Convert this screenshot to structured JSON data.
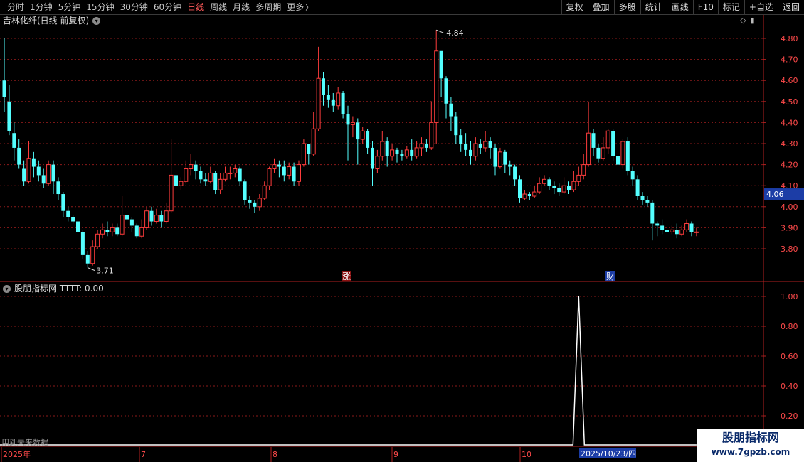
{
  "topbar": {
    "tabs": [
      "分时",
      "1分钟",
      "5分钟",
      "15分钟",
      "30分钟",
      "60分钟",
      "日线",
      "周线",
      "月线",
      "多周期",
      "更多"
    ],
    "active_tab": "日线",
    "tools": [
      "复权",
      "叠加",
      "多股",
      "统计",
      "画线",
      "F10",
      "标记",
      "+自选",
      "返回"
    ]
  },
  "chart_title": "吉林化纤(日线 前复权)",
  "indicator_title": "股朋指标网 TTTT: 0.00",
  "future_note": "用到未来数据",
  "watermark": {
    "line1": "股朋指标网",
    "line2": "www.7gpzb.com"
  },
  "colors": {
    "up": "#ff3c3c",
    "down": "#54ffff",
    "grid": "#8b1a1a",
    "axis_text": "#ff4a4a",
    "line": "#ffffff"
  },
  "chart_data": [
    {
      "type": "candlestick",
      "ylim": [
        3.7,
        4.9
      ],
      "yticks": [
        "4.80",
        "4.70",
        "4.60",
        "4.50",
        "4.40",
        "4.30",
        "4.20",
        "4.10",
        "4.00",
        "3.90",
        "3.80"
      ],
      "current_price": "4.06",
      "annotations": {
        "high": "4.84",
        "low": "3.71"
      },
      "event_marks": [
        "涨",
        "财"
      ],
      "candles": [
        [
          4.6,
          4.52,
          4.8,
          4.45
        ],
        [
          4.5,
          4.36,
          4.58,
          4.34
        ],
        [
          4.35,
          4.28,
          4.4,
          4.22
        ],
        [
          4.28,
          4.2,
          4.32,
          4.18
        ],
        [
          4.18,
          4.12,
          4.22,
          4.1
        ],
        [
          4.12,
          4.23,
          4.31,
          4.11
        ],
        [
          4.23,
          4.19,
          4.26,
          4.14
        ],
        [
          4.19,
          4.15,
          4.22,
          4.12
        ],
        [
          4.15,
          4.11,
          4.18,
          4.09
        ],
        [
          4.11,
          4.2,
          4.22,
          4.1
        ],
        [
          4.2,
          4.12,
          4.22,
          4.06
        ],
        [
          4.12,
          4.06,
          4.14,
          4.03
        ],
        [
          4.06,
          3.98,
          4.07,
          3.95
        ],
        [
          3.98,
          3.95,
          4.0,
          3.93
        ],
        [
          3.95,
          3.93,
          3.96,
          3.92
        ],
        [
          3.93,
          3.88,
          3.95,
          3.86
        ],
        [
          3.88,
          3.77,
          3.89,
          3.75
        ],
        [
          3.77,
          3.73,
          3.79,
          3.71
        ],
        [
          3.73,
          3.81,
          3.84,
          3.72
        ],
        [
          3.81,
          3.87,
          3.89,
          3.8
        ],
        [
          3.87,
          3.89,
          3.92,
          3.85
        ],
        [
          3.89,
          3.88,
          3.93,
          3.86
        ],
        [
          3.88,
          3.9,
          3.92,
          3.86
        ],
        [
          3.9,
          3.87,
          3.92,
          3.86
        ],
        [
          3.87,
          3.96,
          4.05,
          3.86
        ],
        [
          3.96,
          3.94,
          4.0,
          3.92
        ],
        [
          3.94,
          3.91,
          3.95,
          3.88
        ],
        [
          3.91,
          3.86,
          3.92,
          3.85
        ],
        [
          3.86,
          3.9,
          3.94,
          3.85
        ],
        [
          3.9,
          3.98,
          4.0,
          3.89
        ],
        [
          3.98,
          3.93,
          4.0,
          3.91
        ],
        [
          3.93,
          3.96,
          3.99,
          3.92
        ],
        [
          3.96,
          3.93,
          3.98,
          3.9
        ],
        [
          3.93,
          3.98,
          4.02,
          3.92
        ],
        [
          3.98,
          4.15,
          4.32,
          3.97
        ],
        [
          4.15,
          4.1,
          4.17,
          4.02
        ],
        [
          4.1,
          4.12,
          4.14,
          4.08
        ],
        [
          4.12,
          4.18,
          4.22,
          4.11
        ],
        [
          4.18,
          4.2,
          4.25,
          4.15
        ],
        [
          4.2,
          4.17,
          4.22,
          4.13
        ],
        [
          4.17,
          4.13,
          4.19,
          4.11
        ],
        [
          4.13,
          4.12,
          4.16,
          4.1
        ],
        [
          4.12,
          4.16,
          4.19,
          4.11
        ],
        [
          4.16,
          4.08,
          4.17,
          4.06
        ],
        [
          4.08,
          4.13,
          4.16,
          4.06
        ],
        [
          4.13,
          4.16,
          4.19,
          4.12
        ],
        [
          4.16,
          4.16,
          4.19,
          4.13
        ],
        [
          4.16,
          4.18,
          4.2,
          4.14
        ],
        [
          4.18,
          4.12,
          4.19,
          4.1
        ],
        [
          4.12,
          4.03,
          4.13,
          4.01
        ],
        [
          4.03,
          4.02,
          4.05,
          3.99
        ],
        [
          4.02,
          4.0,
          4.03,
          3.97
        ],
        [
          4.0,
          4.04,
          4.06,
          3.98
        ],
        [
          4.04,
          4.1,
          4.12,
          4.03
        ],
        [
          4.1,
          4.18,
          4.19,
          4.08
        ],
        [
          4.18,
          4.2,
          4.23,
          4.16
        ],
        [
          4.2,
          4.19,
          4.22,
          4.14
        ],
        [
          4.19,
          4.15,
          4.22,
          4.12
        ],
        [
          4.15,
          4.19,
          4.21,
          4.13
        ],
        [
          4.19,
          4.12,
          4.21,
          4.1
        ],
        [
          4.12,
          4.2,
          4.22,
          4.1
        ],
        [
          4.2,
          4.3,
          4.32,
          4.19
        ],
        [
          4.3,
          4.25,
          4.3,
          4.2
        ],
        [
          4.25,
          4.37,
          4.45,
          4.24
        ],
        [
          4.37,
          4.61,
          4.76,
          4.36
        ],
        [
          4.61,
          4.53,
          4.64,
          4.48
        ],
        [
          4.53,
          4.51,
          4.58,
          4.47
        ],
        [
          4.51,
          4.48,
          4.54,
          4.45
        ],
        [
          4.48,
          4.54,
          4.57,
          4.46
        ],
        [
          4.54,
          4.44,
          4.55,
          4.42
        ],
        [
          4.44,
          4.39,
          4.48,
          4.22
        ],
        [
          4.39,
          4.4,
          4.43,
          4.33
        ],
        [
          4.4,
          4.32,
          4.42,
          4.2
        ],
        [
          4.32,
          4.36,
          4.38,
          4.3
        ],
        [
          4.36,
          4.28,
          4.37,
          4.25
        ],
        [
          4.28,
          4.18,
          4.31,
          4.1
        ],
        [
          4.18,
          4.24,
          4.27,
          4.16
        ],
        [
          4.24,
          4.31,
          4.36,
          4.22
        ],
        [
          4.31,
          4.24,
          4.33,
          4.19
        ],
        [
          4.24,
          4.27,
          4.3,
          4.22
        ],
        [
          4.27,
          4.25,
          4.28,
          4.21
        ],
        [
          4.25,
          4.24,
          4.27,
          4.22
        ],
        [
          4.24,
          4.27,
          4.29,
          4.23
        ],
        [
          4.27,
          4.24,
          4.32,
          4.22
        ],
        [
          4.24,
          4.28,
          4.31,
          4.23
        ],
        [
          4.28,
          4.3,
          4.33,
          4.24
        ],
        [
          4.3,
          4.28,
          4.32,
          4.26
        ],
        [
          4.28,
          4.4,
          4.5,
          4.27
        ],
        [
          4.4,
          4.74,
          4.84,
          4.3
        ],
        [
          4.74,
          4.61,
          4.66,
          4.52
        ],
        [
          4.61,
          4.49,
          4.62,
          4.42
        ],
        [
          4.49,
          4.43,
          4.52,
          4.36
        ],
        [
          4.43,
          4.34,
          4.45,
          4.3
        ],
        [
          4.34,
          4.3,
          4.37,
          4.26
        ],
        [
          4.3,
          4.27,
          4.35,
          4.24
        ],
        [
          4.27,
          4.24,
          4.31,
          4.2
        ],
        [
          4.24,
          4.3,
          4.33,
          4.22
        ],
        [
          4.3,
          4.28,
          4.32,
          4.25
        ],
        [
          4.28,
          4.31,
          4.36,
          4.26
        ],
        [
          4.31,
          4.28,
          4.33,
          4.23
        ],
        [
          4.28,
          4.19,
          4.3,
          4.15
        ],
        [
          4.19,
          4.26,
          4.28,
          4.18
        ],
        [
          4.26,
          4.2,
          4.27,
          4.16
        ],
        [
          4.2,
          4.19,
          4.22,
          4.15
        ],
        [
          4.19,
          4.13,
          4.2,
          4.1
        ],
        [
          4.13,
          4.04,
          4.15,
          4.02
        ],
        [
          4.04,
          4.06,
          4.08,
          4.03
        ],
        [
          4.06,
          4.05,
          4.07,
          4.03
        ],
        [
          4.05,
          4.07,
          4.1,
          4.04
        ],
        [
          4.07,
          4.11,
          4.14,
          4.06
        ],
        [
          4.11,
          4.13,
          4.15,
          4.1
        ],
        [
          4.13,
          4.1,
          4.14,
          4.08
        ],
        [
          4.1,
          4.09,
          4.12,
          4.06
        ],
        [
          4.09,
          4.07,
          4.11,
          4.05
        ],
        [
          4.07,
          4.1,
          4.14,
          4.06
        ],
        [
          4.1,
          4.08,
          4.12,
          4.06
        ],
        [
          4.08,
          4.12,
          4.17,
          4.07
        ],
        [
          4.12,
          4.15,
          4.19,
          4.1
        ],
        [
          4.15,
          4.2,
          4.25,
          4.13
        ],
        [
          4.2,
          4.35,
          4.5,
          4.19
        ],
        [
          4.35,
          4.28,
          4.37,
          4.24
        ],
        [
          4.28,
          4.23,
          4.3,
          4.21
        ],
        [
          4.23,
          4.28,
          4.33,
          4.22
        ],
        [
          4.28,
          4.36,
          4.37,
          4.25
        ],
        [
          4.36,
          4.24,
          4.37,
          4.22
        ],
        [
          4.24,
          4.2,
          4.26,
          4.17
        ],
        [
          4.2,
          4.31,
          4.32,
          4.18
        ],
        [
          4.31,
          4.17,
          4.33,
          4.15
        ],
        [
          4.17,
          4.13,
          4.19,
          4.1
        ],
        [
          4.13,
          4.05,
          4.15,
          4.03
        ],
        [
          4.05,
          4.03,
          4.07,
          4.01
        ],
        [
          4.03,
          4.02,
          4.05,
          4.0
        ],
        [
          4.02,
          3.92,
          4.03,
          3.84
        ],
        [
          3.92,
          3.91,
          3.93,
          3.86
        ],
        [
          3.91,
          3.89,
          3.94,
          3.87
        ],
        [
          3.89,
          3.88,
          3.91,
          3.86
        ],
        [
          3.88,
          3.89,
          3.91,
          3.87
        ],
        [
          3.89,
          3.87,
          3.92,
          3.85
        ],
        [
          3.87,
          3.89,
          3.91,
          3.86
        ],
        [
          3.89,
          3.92,
          3.94,
          3.88
        ],
        [
          3.92,
          3.88,
          3.93,
          3.86
        ],
        [
          3.88,
          3.88,
          3.9,
          3.86
        ]
      ]
    },
    {
      "type": "line",
      "name": "TTTT",
      "ylim": [
        0.1,
        1.1
      ],
      "yticks": [
        "1.00",
        "0.80",
        "0.60",
        "0.40",
        "0.20"
      ],
      "spike_index": 117,
      "values_note": "all zero except 1.00 on one day"
    }
  ],
  "time_axis": {
    "labels": [
      "2025年",
      "7",
      "8",
      "9",
      "10"
    ],
    "cursor_label": "2025/10/23/四"
  }
}
